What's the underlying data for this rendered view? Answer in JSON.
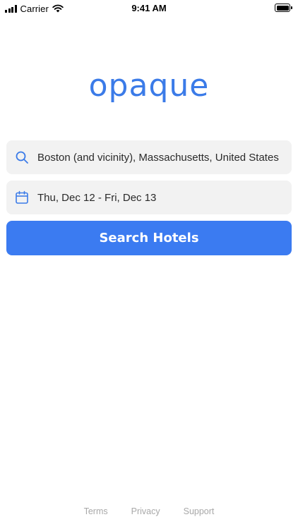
{
  "status_bar": {
    "carrier": "Carrier",
    "time": "9:41 AM",
    "icons": [
      "signal-icon",
      "wifi-icon",
      "battery-icon"
    ]
  },
  "brand": {
    "logo_text": "opaque",
    "accent_color": "#3b7be8"
  },
  "search_form": {
    "destination": {
      "icon": "search-icon",
      "value": "Boston (and vicinity), Massachusetts, United States"
    },
    "dates": {
      "icon": "calendar-icon",
      "value": "Thu, Dec 12 - Fri, Dec 13"
    },
    "submit_label": "Search Hotels",
    "button_color": "#3b7bf1"
  },
  "footer": {
    "links": [
      "Terms",
      "Privacy",
      "Support"
    ]
  }
}
